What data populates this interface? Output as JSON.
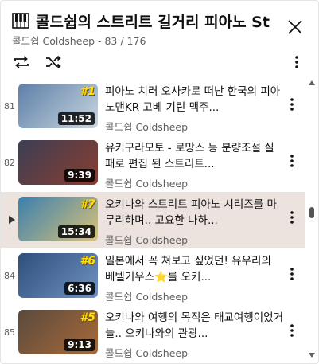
{
  "playlist": {
    "title": "콜드쉽의 스트리트 길거리 피아노 St",
    "channel": "콜드쉽 Coldsheep",
    "position": " - 83 / 176"
  },
  "icons": [
    "piano-icon",
    "close-icon",
    "loop-icon",
    "shuffle-icon",
    "more-vert-icon",
    "play-arrow-icon"
  ],
  "items": [
    {
      "index": "81",
      "title": "피아노 치러 오사카로 떠난 한국의 피아노맨KR 고베 기린 맥주...",
      "channel": "콜드쉽 Coldsheep",
      "duration": "11:52",
      "rank": "#1",
      "active": false,
      "colors": [
        "#5d7fa8",
        "#c9d6df"
      ]
    },
    {
      "index": "82",
      "title": "유키구라모토 - 로망스 등 분량조절 실패로 편집 된 스트리트...",
      "channel": "콜드쉽 Coldsheep",
      "duration": "9:39",
      "rank": "",
      "active": false,
      "colors": [
        "#3b3f55",
        "#8a3d2f"
      ]
    },
    {
      "index": "",
      "title": "오키나와 스트리트 피아노 시리즈를 마무리하며.. 고요한 나하...",
      "channel": "콜드쉽 Coldsheep",
      "duration": "15:34",
      "rank": "#7",
      "active": true,
      "colors": [
        "#3a7fae",
        "#d9c27a"
      ]
    },
    {
      "index": "84",
      "title": "일본에서 꼭 쳐보고 싶었던! 유우리의 베텔기우스⭐를 오키...",
      "channel": "콜드쉽 Coldsheep",
      "duration": "6:36",
      "rank": "#6",
      "active": false,
      "colors": [
        "#2f4e7a",
        "#6f93c4"
      ]
    },
    {
      "index": "85",
      "title": "오키나와 여행의 목적은 태교여행이었거늘.. 오키나와의 관광...",
      "channel": "콜드쉽 Coldsheep",
      "duration": "9:13",
      "rank": "#5",
      "active": false,
      "colors": [
        "#5a4a3c",
        "#a86a3a"
      ]
    }
  ]
}
